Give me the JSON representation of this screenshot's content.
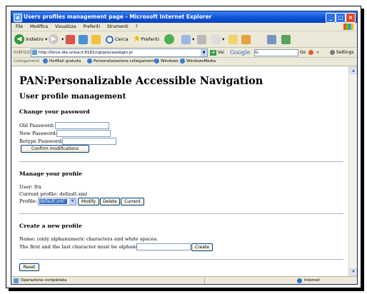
{
  "window": {
    "title": "Users profiles management page - Microsoft Internet Explorer",
    "controls": {
      "minimize": "_",
      "maximize": "□",
      "close": "×"
    }
  },
  "menu": [
    "File",
    "Modifica",
    "Visualizza",
    "Preferiti",
    "Strumenti",
    "?"
  ],
  "toolbar": {
    "back": "Indietro",
    "search": "Cerca",
    "favorites": "Preferiti"
  },
  "address": {
    "label": "Indirizzo",
    "url": "http://forus.dia.unisa.it:8181/cgi/processlogin.pl",
    "go": "Vai",
    "google": "Google",
    "google_field": "G-",
    "go_label": "Go",
    "more": "»",
    "settings": "Settings"
  },
  "links": {
    "label": "Collegamenti",
    "items": [
      "HotMail gratuita",
      "Personalizzazione collegamenti",
      "Windows",
      "WindowsMedia"
    ]
  },
  "page": {
    "heading": "PAN:Personalizable Accessible Navigation",
    "subheading": "User profile management",
    "change_password": {
      "title": "Change your password",
      "old_label": "Old Password:",
      "new_label": "New Password:",
      "retype_label": "Retype Password:",
      "confirm_button": "Confirm modifications"
    },
    "manage_profile": {
      "title": "Manage your profile",
      "user_line": "User: fra",
      "current_line": "Current profile: default.xml",
      "profile_label": "Profile:",
      "selected_profile": "default.xml",
      "modify_button": "Modify",
      "delete_button": "Delete",
      "current_button": "Current"
    },
    "new_profile": {
      "title": "Create a new profile",
      "name_hint": "Name: (only alphanumeric characters and white spaces.",
      "rule_hint": "The first and the last character must be alphanumeric)",
      "create_button": "Create"
    },
    "reset_button": "Reset"
  },
  "status": {
    "text": "Operazione completata",
    "zone": "Internet"
  },
  "colors": {
    "titlebar": "#0a4fd6",
    "close": "#e04a2c",
    "selection": "#316ac5"
  }
}
